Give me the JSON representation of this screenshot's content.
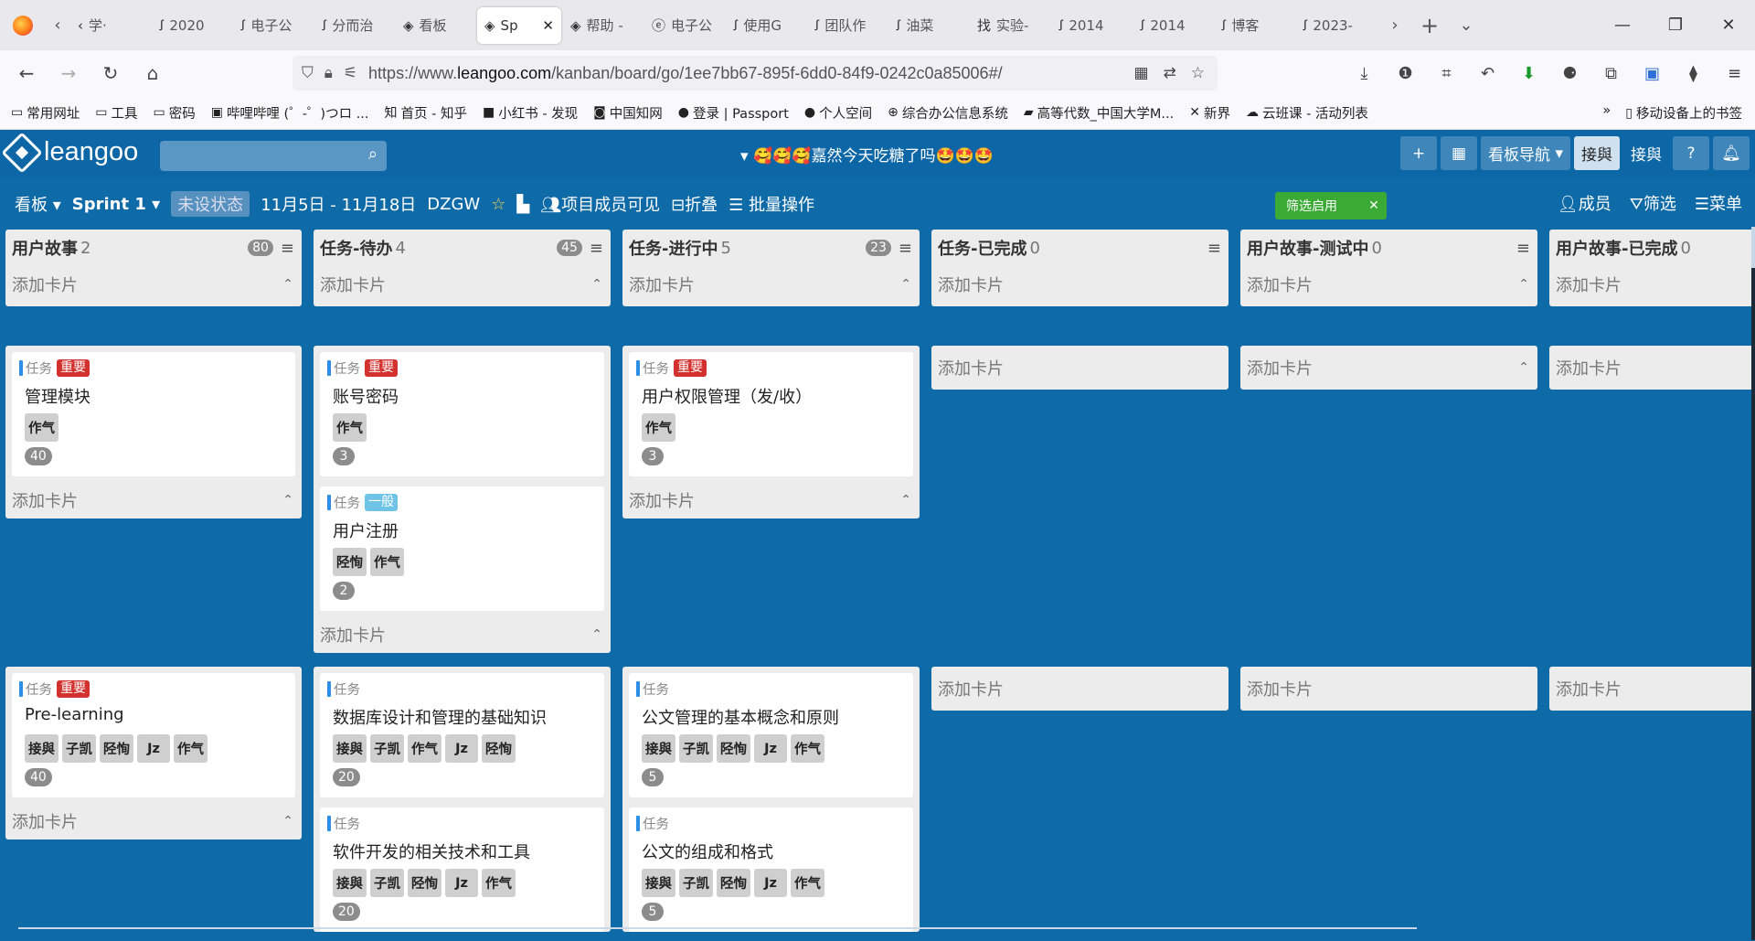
{
  "browser": {
    "tabs": [
      {
        "label": "学·",
        "icon": "‹"
      },
      {
        "label": "2020",
        "icon": "ꭍ"
      },
      {
        "label": "电子公",
        "icon": "ꭍ"
      },
      {
        "label": "分而治",
        "icon": "ꭍ"
      },
      {
        "label": "看板",
        "icon": "◈"
      },
      {
        "label": "Sp",
        "icon": "◈",
        "active": true
      },
      {
        "label": "帮助 -",
        "icon": "◈"
      },
      {
        "label": "电子公",
        "icon": "ⓔ"
      },
      {
        "label": "使用G",
        "icon": "ꭍ"
      },
      {
        "label": "团队作",
        "icon": "ꭍ"
      },
      {
        "label": "油菜",
        "icon": "ꭍ"
      },
      {
        "label": "实验-",
        "icon": "找"
      },
      {
        "label": "2014",
        "icon": "ꭍ"
      },
      {
        "label": "2014",
        "icon": "ꭍ"
      },
      {
        "label": "博客",
        "icon": "ꭍ"
      },
      {
        "label": "2023-",
        "icon": "ꭍ"
      }
    ],
    "url_prefix": "https://www.",
    "url_domain": "leangoo.com",
    "url_path": "/kanban/board/go/1ee7bb67-895f-6dd0-84f9-0242c0a85006#/",
    "bookmarks": [
      {
        "label": "常用网址",
        "icon": "▭"
      },
      {
        "label": "工具",
        "icon": "▭"
      },
      {
        "label": "密码",
        "icon": "▭"
      },
      {
        "label": "哔哩哔哩 (゜-゜)つロ ...",
        "icon": "▣"
      },
      {
        "label": "首页 - 知乎",
        "icon": "知"
      },
      {
        "label": "小红书 - 发现",
        "icon": "■"
      },
      {
        "label": "中国知网",
        "icon": "◙"
      },
      {
        "label": "登录 | Passport",
        "icon": "●"
      },
      {
        "label": "个人空间",
        "icon": "●"
      },
      {
        "label": "综合办公信息系统",
        "icon": "⊕"
      },
      {
        "label": "高等代数_中国大学M...",
        "icon": "▰"
      },
      {
        "label": "新界",
        "icon": "✕"
      },
      {
        "label": "云班课 - 活动列表",
        "icon": "☁"
      }
    ],
    "bookmarks_more": "»",
    "mobile_bookmarks": "移动设备上的书签"
  },
  "app": {
    "logo_text": "leangoo",
    "board_title": "🥰🥰🥰嘉然今天吃糖了吗🤩🤩🤩",
    "nav_label": "看板导航",
    "jie_label": "接與",
    "jie2_label": "接與",
    "help": "?",
    "sprint_bar": {
      "board_menu": "看板",
      "sprint": "Sprint 1",
      "state": "未设状态",
      "dates": "11月5日 - 11月18日",
      "team": "DZGW",
      "visibility": "项目成员可见",
      "fold": "折叠",
      "batch": "批量操作",
      "filter_on": "筛选启用",
      "members": "成员",
      "filter": "筛选",
      "menu": "菜单"
    },
    "add_card": "添加卡片",
    "columns": [
      {
        "title": "用户故事",
        "count": "2",
        "points": "80"
      },
      {
        "title": "任务-待办",
        "count": "4",
        "points": "45"
      },
      {
        "title": "任务-进行中",
        "count": "5",
        "points": "23"
      },
      {
        "title": "任务-已完成",
        "count": "0"
      },
      {
        "title": "用户故事-测试中",
        "count": "0"
      },
      {
        "title": "用户故事-已完成",
        "count": "0"
      }
    ],
    "card_type": "任务",
    "priority_important": "重要",
    "priority_normal": "一般",
    "cards": {
      "r1c1": {
        "title": "管理模块",
        "members": [
          "作气"
        ],
        "points": "40"
      },
      "r1c2a": {
        "title": "账号密码",
        "members": [
          "作气"
        ],
        "points": "3"
      },
      "r1c2b": {
        "title": "用户注册",
        "members": [
          "陉恂",
          "作气"
        ],
        "points": "2"
      },
      "r1c3": {
        "title": "用户权限管理（发/收）",
        "members": [
          "作气"
        ],
        "points": "3"
      },
      "r2c1": {
        "title": "Pre-learning",
        "members": [
          "接與",
          "子凯",
          "陉恂",
          "Jz",
          "作气"
        ],
        "points": "40"
      },
      "r2c2a": {
        "title": "数据库设计和管理的基础知识",
        "members": [
          "接與",
          "子凯",
          "作气",
          "Jz",
          "陉恂"
        ],
        "points": "20"
      },
      "r2c2b": {
        "title": "软件开发的相关技术和工具",
        "members": [
          "接與",
          "子凯",
          "陉恂",
          "Jz",
          "作气"
        ],
        "points": "20"
      },
      "r2c3a": {
        "title": "公文管理的基本概念和原则",
        "members": [
          "接與",
          "子凯",
          "陉恂",
          "Jz",
          "作气"
        ],
        "points": "5"
      },
      "r2c3b": {
        "title": "公文的组成和格式",
        "members": [
          "接與",
          "子凯",
          "陉恂",
          "Jz",
          "作气"
        ],
        "points": "5"
      }
    }
  }
}
